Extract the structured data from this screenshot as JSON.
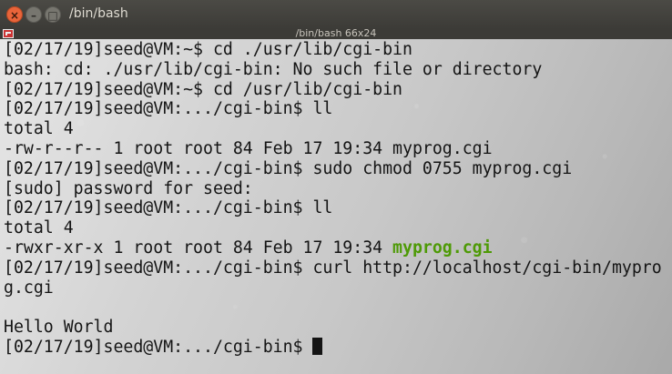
{
  "window": {
    "title": "/bin/bash",
    "close_glyph": "×",
    "minimize_glyph": "–",
    "maximize_glyph": "□"
  },
  "tab": {
    "label": "/bin/bash 66x24"
  },
  "colors": {
    "text": "#141414",
    "executable": "#4e9a06",
    "close_button": "#e9643a",
    "titlebar": "#3c3b37"
  },
  "terminal": {
    "lines": [
      "[02/17/19]seed@VM:~$ cd ./usr/lib/cgi-bin",
      "bash: cd: ./usr/lib/cgi-bin: No such file or directory",
      "[02/17/19]seed@VM:~$ cd /usr/lib/cgi-bin",
      "[02/17/19]seed@VM:.../cgi-bin$ ll",
      "total 4",
      "-rw-r--r-- 1 root root 84 Feb 17 19:34 myprog.cgi",
      "[02/17/19]seed@VM:.../cgi-bin$ sudo chmod 0755 myprog.cgi",
      "[sudo] password for seed:",
      "[02/17/19]seed@VM:.../cgi-bin$ ll",
      "total 4",
      "-rwxr-xr-x 1 root root 84 Feb 17 19:34 ",
      "[02/17/19]seed@VM:.../cgi-bin$ curl http://localhost/cgi-bin/mypro",
      "g.cgi",
      "",
      "Hello World",
      "[02/17/19]seed@VM:.../cgi-bin$ "
    ],
    "executable_name": "myprog.cgi"
  }
}
